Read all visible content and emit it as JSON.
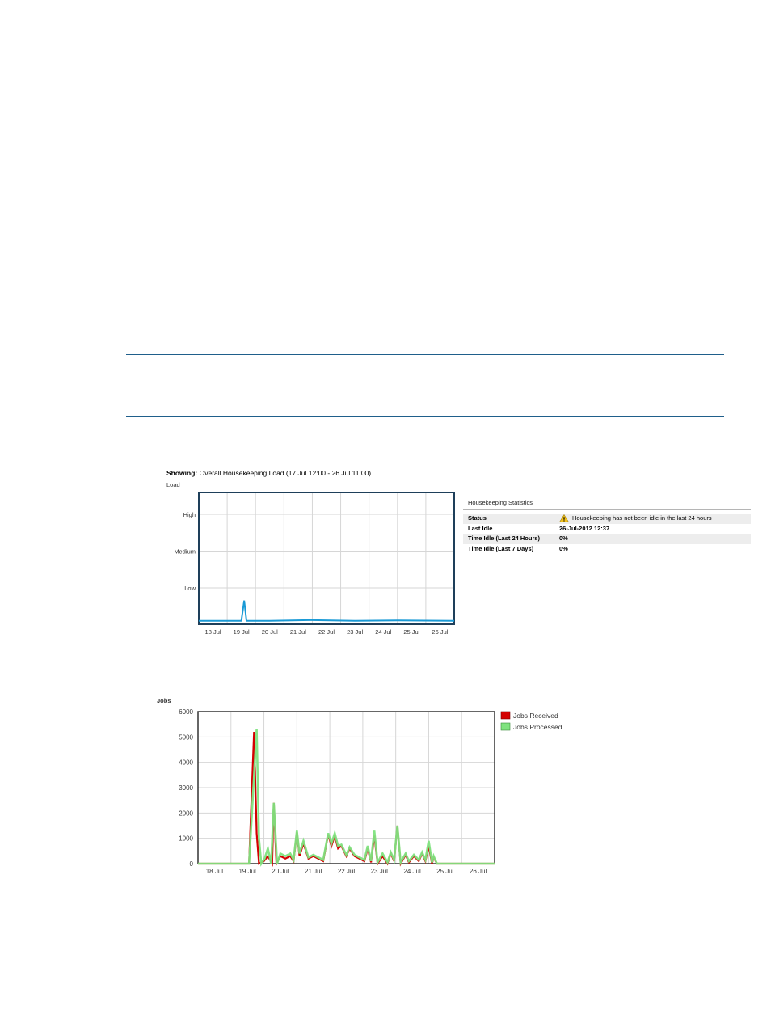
{
  "page": {
    "showing_prefix": "Showing:",
    "showing_text": "Overall Housekeeping Load (17 Jul 12:00 - 26 Jul 11:00)"
  },
  "stats": {
    "title": "Housekeeping Statistics",
    "rows": [
      {
        "key": "Status",
        "value": "Housekeeping has not been idle in the last 24 hours",
        "icon": "warning-icon"
      },
      {
        "key": "Last Idle",
        "value": "26-Jul-2012 12:37"
      },
      {
        "key": "Time Idle (Last 24 Hours)",
        "value": "0%"
      },
      {
        "key": "Time Idle (Last 7 Days)",
        "value": "0%"
      }
    ]
  },
  "colors": {
    "rule": "#1f5f8b",
    "load_line": "#1a9ad6",
    "received": "#d40000",
    "processed": "#7fe37f",
    "plot_border": "#1e3f5a"
  },
  "chart_data": [
    {
      "type": "line",
      "ylabel": "Load",
      "y_categories": [
        "Low",
        "Medium",
        "High"
      ],
      "x_ticks": [
        "18 Jul",
        "19 Jul",
        "20 Jul",
        "21 Jul",
        "22 Jul",
        "23 Jul",
        "24 Jul",
        "25 Jul",
        "26 Jul"
      ],
      "grid": true,
      "series": [
        {
          "points": [
            [
              0,
              0.05
            ],
            [
              1.5,
              0.05
            ],
            [
              1.6,
              0.6
            ],
            [
              1.68,
              0.05
            ],
            [
              2.5,
              0.05
            ],
            [
              4,
              0.07
            ],
            [
              5.5,
              0.05
            ],
            [
              7,
              0.06
            ],
            [
              9,
              0.05
            ]
          ]
        }
      ]
    },
    {
      "type": "line",
      "ylabel": "Jobs",
      "ylim": [
        0,
        6000
      ],
      "y_ticks": [
        0,
        1000,
        2000,
        3000,
        4000,
        5000,
        6000
      ],
      "x_ticks": [
        "18 Jul",
        "19 Jul",
        "20 Jul",
        "21 Jul",
        "22 Jul",
        "23 Jul",
        "24 Jul",
        "25 Jul",
        "26 Jul"
      ],
      "grid": true,
      "legend": "top-right",
      "series": [
        {
          "name": "Jobs Received",
          "points": [
            [
              0,
              0
            ],
            [
              1.55,
              0
            ],
            [
              1.7,
              5200
            ],
            [
              1.78,
              1200
            ],
            [
              1.85,
              0
            ],
            [
              2.0,
              100
            ],
            [
              2.12,
              300
            ],
            [
              2.25,
              0
            ],
            [
              2.3,
              2400
            ],
            [
              2.38,
              0
            ],
            [
              2.5,
              300
            ],
            [
              2.65,
              200
            ],
            [
              2.8,
              300
            ],
            [
              2.9,
              100
            ],
            [
              3.0,
              1250
            ],
            [
              3.08,
              300
            ],
            [
              3.2,
              800
            ],
            [
              3.35,
              200
            ],
            [
              3.5,
              300
            ],
            [
              3.65,
              200
            ],
            [
              3.8,
              100
            ],
            [
              3.95,
              1150
            ],
            [
              4.05,
              700
            ],
            [
              4.15,
              1100
            ],
            [
              4.25,
              600
            ],
            [
              4.35,
              700
            ],
            [
              4.5,
              300
            ],
            [
              4.6,
              600
            ],
            [
              4.75,
              300
            ],
            [
              4.9,
              200
            ],
            [
              5.05,
              100
            ],
            [
              5.15,
              600
            ],
            [
              5.25,
              50
            ],
            [
              5.35,
              1100
            ],
            [
              5.45,
              0
            ],
            [
              5.6,
              300
            ],
            [
              5.75,
              0
            ],
            [
              5.85,
              400
            ],
            [
              5.95,
              100
            ],
            [
              6.05,
              1500
            ],
            [
              6.15,
              0
            ],
            [
              6.3,
              350
            ],
            [
              6.4,
              50
            ],
            [
              6.55,
              300
            ],
            [
              6.7,
              100
            ],
            [
              6.8,
              400
            ],
            [
              6.9,
              100
            ],
            [
              7.0,
              700
            ],
            [
              7.1,
              0
            ],
            [
              7.15,
              250
            ],
            [
              7.25,
              0
            ],
            [
              9,
              0
            ]
          ]
        },
        {
          "name": "Jobs Processed",
          "points": [
            [
              0,
              0
            ],
            [
              1.55,
              0
            ],
            [
              1.78,
              5300
            ],
            [
              1.85,
              1000
            ],
            [
              1.92,
              0
            ],
            [
              2.02,
              200
            ],
            [
              2.12,
              600
            ],
            [
              2.22,
              0
            ],
            [
              2.3,
              2400
            ],
            [
              2.4,
              0
            ],
            [
              2.5,
              400
            ],
            [
              2.65,
              300
            ],
            [
              2.8,
              400
            ],
            [
              2.9,
              150
            ],
            [
              3.0,
              1300
            ],
            [
              3.08,
              400
            ],
            [
              3.2,
              900
            ],
            [
              3.35,
              250
            ],
            [
              3.5,
              350
            ],
            [
              3.65,
              250
            ],
            [
              3.8,
              150
            ],
            [
              3.95,
              1200
            ],
            [
              4.05,
              800
            ],
            [
              4.15,
              1200
            ],
            [
              4.25,
              700
            ],
            [
              4.35,
              750
            ],
            [
              4.5,
              350
            ],
            [
              4.6,
              650
            ],
            [
              4.75,
              350
            ],
            [
              4.9,
              250
            ],
            [
              5.05,
              150
            ],
            [
              5.15,
              700
            ],
            [
              5.25,
              100
            ],
            [
              5.35,
              1300
            ],
            [
              5.45,
              50
            ],
            [
              5.6,
              400
            ],
            [
              5.75,
              50
            ],
            [
              5.85,
              450
            ],
            [
              5.95,
              150
            ],
            [
              6.05,
              1500
            ],
            [
              6.15,
              50
            ],
            [
              6.3,
              400
            ],
            [
              6.4,
              100
            ],
            [
              6.55,
              350
            ],
            [
              6.7,
              150
            ],
            [
              6.8,
              450
            ],
            [
              6.9,
              150
            ],
            [
              7.0,
              900
            ],
            [
              7.1,
              50
            ],
            [
              7.15,
              300
            ],
            [
              7.25,
              0
            ],
            [
              9,
              0
            ]
          ]
        }
      ]
    }
  ]
}
